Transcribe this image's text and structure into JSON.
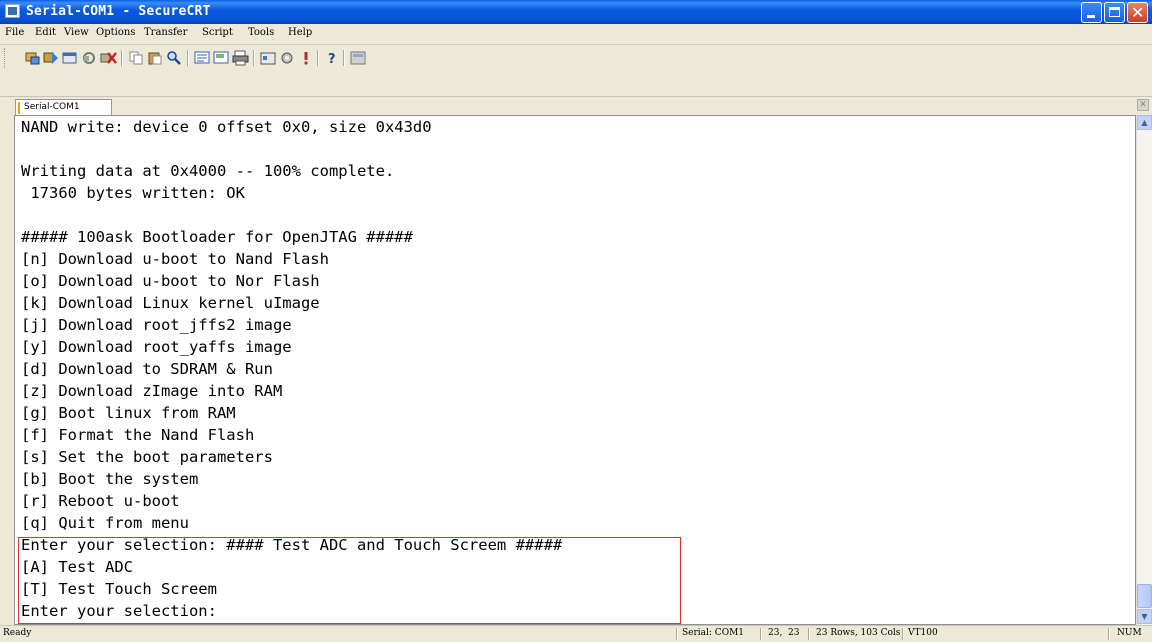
{
  "window": {
    "title": "Serial-COM1 - SecureCRT"
  },
  "menu": [
    "File",
    "Edit",
    "View",
    "Options",
    "Transfer",
    "Script",
    "Tools",
    "Help"
  ],
  "toolbar": {
    "icons": [
      "connect-icon",
      "quick-connect-icon",
      "connect-tab-icon",
      "reconnect-icon",
      "disconnect-icon",
      "copy-icon",
      "paste-icon",
      "find-icon",
      "print-screen-icon",
      "print-selection-icon",
      "print-icon",
      "session-options-icon",
      "global-options-icon",
      "keymap-icon",
      "help-icon",
      "sftp-icon"
    ]
  },
  "tab": {
    "label": "Serial-COM1"
  },
  "terminal": {
    "lines": [
      "NAND write: device 0 offset 0x0, size 0x43d0",
      "",
      "Writing data at 0x4000 -- 100% complete.",
      " 17360 bytes written: OK",
      "",
      "##### 100ask Bootloader for OpenJTAG #####",
      "[n] Download u-boot to Nand Flash",
      "[o] Download u-boot to Nor Flash",
      "[k] Download Linux kernel uImage",
      "[j] Download root_jffs2 image",
      "[y] Download root_yaffs image",
      "[d] Download to SDRAM & Run",
      "[z] Download zImage into RAM",
      "[g] Boot linux from RAM",
      "[f] Format the Nand Flash",
      "[s] Set the boot parameters",
      "[b] Boot the system",
      "[r] Reboot u-boot",
      "[q] Quit from menu",
      "Enter your selection: #### Test ADC and Touch Screem #####",
      "[A] Test ADC",
      "[T] Test Touch Screem",
      "Enter your selection:"
    ]
  },
  "status": {
    "ready": "Ready",
    "port": "Serial: COM1",
    "position": "23,  23",
    "size": "23 Rows, 103 Cols",
    "emulation": "VT100",
    "num": "NUM"
  }
}
